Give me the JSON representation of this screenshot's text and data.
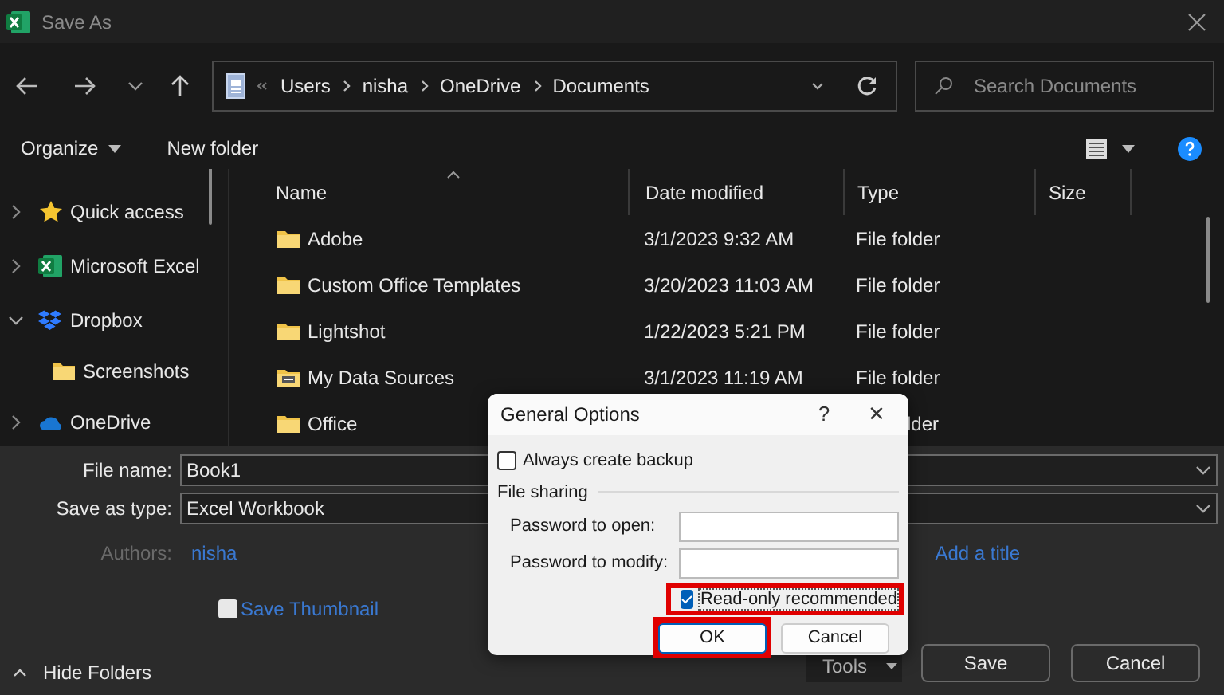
{
  "window": {
    "title": "Save As"
  },
  "address": {
    "path": [
      "Users",
      "nisha",
      "OneDrive",
      "Documents"
    ]
  },
  "search": {
    "placeholder": "Search Documents"
  },
  "toolbar": {
    "organize": "Organize",
    "new_folder": "New folder"
  },
  "sidebar": {
    "items": [
      {
        "label": "Quick access",
        "expanded": false
      },
      {
        "label": "Microsoft Excel",
        "expanded": false
      },
      {
        "label": "Dropbox",
        "expanded": true,
        "children": [
          {
            "label": "Screenshots"
          }
        ]
      },
      {
        "label": "OneDrive",
        "expanded": false
      }
    ]
  },
  "table": {
    "columns": [
      "Name",
      "Date modified",
      "Type",
      "Size"
    ],
    "rows": [
      {
        "name": "Adobe",
        "date": "3/1/2023 9:32 AM",
        "type": "File folder"
      },
      {
        "name": "Custom Office Templates",
        "date": "3/20/2023 11:03 AM",
        "type": "File folder"
      },
      {
        "name": "Lightshot",
        "date": "1/22/2023 5:21 PM",
        "type": "File folder"
      },
      {
        "name": "My Data Sources",
        "date": "3/1/2023 11:19 AM",
        "type": "File folder"
      },
      {
        "name": "Office",
        "type": "lder"
      }
    ]
  },
  "form": {
    "file_name_label": "File name:",
    "file_name": "Book1",
    "type_label": "Save as type:",
    "type_value": "Excel Workbook",
    "authors_label": "Authors:",
    "author": "nisha",
    "title_link": "Add a title",
    "thumbnail": {
      "label": "Save Thumbnail",
      "checked": false
    }
  },
  "footer": {
    "hide_folders": "Hide Folders",
    "tools": "Tools",
    "save": "Save",
    "cancel": "Cancel"
  },
  "dialog": {
    "title": "General Options",
    "help": "?",
    "close": "×",
    "backup": {
      "label": "Always create backup",
      "checked": false
    },
    "section": "File sharing",
    "fields": [
      {
        "label": "Password to open:"
      },
      {
        "label": "Password to modify:"
      }
    ],
    "read_only": {
      "label": "Read-only recommended",
      "checked": true,
      "highlighted": true
    },
    "buttons": [
      {
        "label": "OK",
        "highlighted": true
      },
      {
        "label": "Cancel",
        "highlighted": false
      }
    ]
  }
}
